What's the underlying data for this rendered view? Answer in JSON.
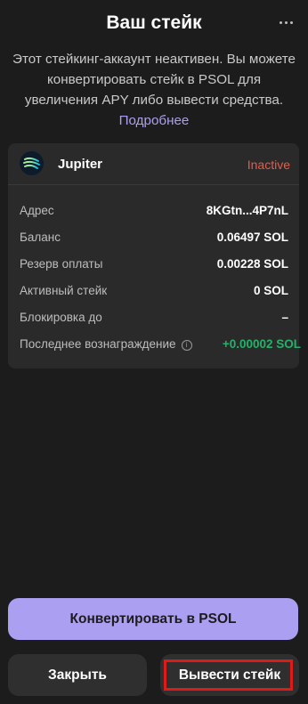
{
  "header": {
    "title": "Ваш стейк",
    "menu_icon": "more-horizontal-icon"
  },
  "notice": {
    "text": "Этот стейкинг-аккаунт неактивен. Вы можете конвертировать стейк в PSOL для увеличения APY либо вывести средства.",
    "link": "Подробнее"
  },
  "stake": {
    "provider": "Jupiter",
    "provider_icon": "jupiter-logo",
    "status": "Inactive",
    "status_color": "#eb5a48",
    "rows": [
      {
        "label": "Адрес",
        "value": "8KGtn...4P7nL"
      },
      {
        "label": "Баланс",
        "value": "0.06497 SOL"
      },
      {
        "label": "Резерв оплаты",
        "value": "0.00228 SOL"
      },
      {
        "label": "Активный стейк",
        "value": "0 SOL"
      },
      {
        "label": "Блокировка до",
        "value": "–"
      },
      {
        "label": "Последнее вознаграждение",
        "value": "+0.00002 SOL",
        "info_icon": "info-icon",
        "value_color": "#21b36a"
      }
    ]
  },
  "actions": {
    "convert": "Конвертировать в PSOL",
    "close": "Закрыть",
    "withdraw": "Вывести стейк"
  },
  "colors": {
    "accent": "#ab9ff2",
    "background": "#1c1c1c",
    "card": "#2a2a2a",
    "positive": "#21b36a"
  }
}
